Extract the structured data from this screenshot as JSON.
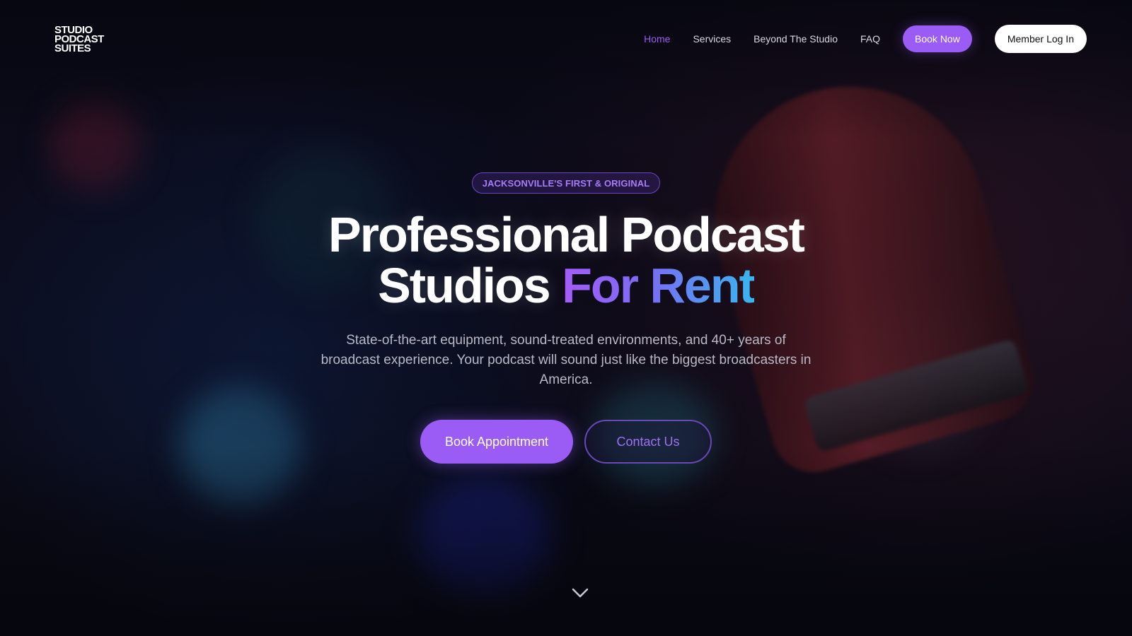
{
  "logo": {
    "lines": [
      "STUDIO",
      "PODCAST",
      "SUITES"
    ]
  },
  "nav": {
    "items": [
      {
        "label": "Home",
        "active": true
      },
      {
        "label": "Services",
        "active": false
      },
      {
        "label": "Beyond The Studio",
        "active": false
      },
      {
        "label": "FAQ",
        "active": false
      }
    ],
    "book_now_label": "Book Now",
    "member_login_label": "Member Log In"
  },
  "hero": {
    "badge": "JACKSONVILLE'S FIRST & ORIGINAL",
    "headline_line1": "Professional Podcast",
    "headline_line2_plain": "Studios",
    "headline_line2_accent": "For Rent",
    "subtitle": "State-of-the-art equipment, sound-treated environments, and 40+ years of broadcast experience. Your podcast will sound just like the biggest broadcasters in America.",
    "primary_cta": "Book Appointment",
    "secondary_cta": "Contact Us"
  },
  "icons": {
    "scroll": "chevron-down-icon",
    "background": "microphone-photo"
  },
  "colors": {
    "accent": "#9b5cf6",
    "accent_gradient_end": "#38b6f0",
    "background": "#0a0a14",
    "text": "#ffffff"
  }
}
